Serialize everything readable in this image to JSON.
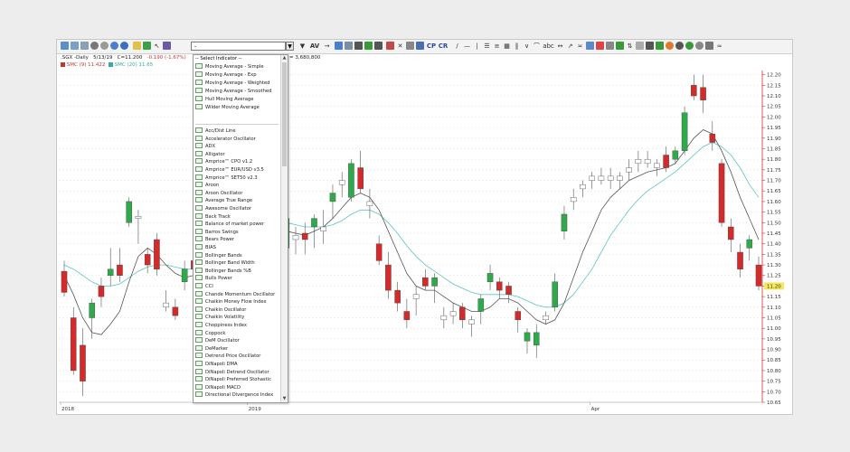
{
  "toolbar": {
    "indicator_select_value": "-",
    "chart_type_label": "AV",
    "cp_label": "CP",
    "cr_label": "CR",
    "abc_label": "abc"
  },
  "chart_header": {
    "symbol": ".SGX -Daily",
    "date": "5/13/19",
    "close": "C=11.200",
    "change": "-0.190 (-1.67%)",
    "volume": "= 3,680,800",
    "legend": [
      {
        "label": "SMC (9) 11.422",
        "color": "#c0392b"
      },
      {
        "label": "SMC (20) 11.65",
        "color": "#3aa6a6"
      }
    ]
  },
  "dropdown": {
    "title": "-- Select Indicator --",
    "moving_averages": [
      "Moving Average - Simple",
      "Moving Average - Exp",
      "Moving Average - Weighted",
      "Moving Average - Smoothed",
      "Hull Moving Average",
      "Wilder Moving Average"
    ],
    "indicators": [
      "Acc/Dist Line",
      "Accelerator Oscillator",
      "ADX",
      "Alligator",
      "Amprice™ CPO v1.2",
      "Amprice™ EUR/USD v3.5",
      "Amprice™ SET50 v2.3",
      "Aroon",
      "Aroon Oscillator",
      "Average True Range",
      "Awesome Oscillator",
      "Back Track",
      "Balance of market power",
      "Barros Swings",
      "Bears Power",
      "BIAS",
      "Bollinger Bands",
      "Bollinger Band Width",
      "Bollinger Bands %B",
      "Bulls Power",
      "CCI",
      "Chande Momentum Oscillator",
      "Chaikin Money Flow Index",
      "Chaikin Oscillator",
      "Chaikin Volatility",
      "Choppiness Index",
      "Coppock",
      "DeM Oscillator",
      "DeMarker",
      "Detrend Price Oscillator",
      "DiNapoli DMA",
      "DiNapoli Detrend Oscillator",
      "DiNapoli Preferred Stohastic",
      "DiNapoli MACD",
      "Directional Divergence Index"
    ]
  },
  "chart_data": {
    "type": "candlestick",
    "x_labels": [
      "2018",
      "2019",
      "Apr"
    ],
    "y_ticks": [
      12.2,
      12.15,
      12.1,
      12.05,
      12.0,
      11.95,
      11.9,
      11.85,
      11.8,
      11.75,
      11.7,
      11.65,
      11.6,
      11.55,
      11.5,
      11.45,
      11.4,
      11.35,
      11.3,
      11.25,
      11.2,
      11.15,
      11.1,
      11.05,
      11.0,
      10.95,
      10.9,
      10.85,
      10.8,
      10.75,
      10.7,
      10.65
    ],
    "ylim": [
      10.65,
      12.22
    ],
    "last_price": "11.20",
    "colors": {
      "up": "#2eaa4a",
      "down": "#d42a2a",
      "neutral": "#ffffff",
      "ma_fast": "#555555",
      "ma_slow": "#5cc4c4",
      "last_price_bg": "#f5e65a"
    },
    "candles": [
      {
        "o": 11.27,
        "h": 11.32,
        "l": 11.15,
        "c": 11.17
      },
      {
        "o": 11.05,
        "h": 11.1,
        "l": 10.78,
        "c": 10.8
      },
      {
        "o": 10.92,
        "h": 11.0,
        "l": 10.68,
        "c": 10.75
      },
      {
        "o": 11.05,
        "h": 11.14,
        "l": 10.95,
        "c": 11.12
      },
      {
        "o": 11.2,
        "h": 11.24,
        "l": 11.1,
        "c": 11.15
      },
      {
        "o": 11.25,
        "h": 11.38,
        "l": 11.2,
        "c": 11.28
      },
      {
        "o": 11.3,
        "h": 11.38,
        "l": 11.22,
        "c": 11.25
      },
      {
        "o": 11.5,
        "h": 11.62,
        "l": 11.48,
        "c": 11.6
      },
      {
        "o": 11.52,
        "h": 11.56,
        "l": 11.4,
        "c": 11.53
      },
      {
        "o": 11.35,
        "h": 11.38,
        "l": 11.26,
        "c": 11.3
      },
      {
        "o": 11.42,
        "h": 11.45,
        "l": 11.25,
        "c": 11.28
      },
      {
        "o": 11.12,
        "h": 11.18,
        "l": 11.08,
        "c": 11.1
      },
      {
        "o": 11.1,
        "h": 11.14,
        "l": 11.04,
        "c": 11.06
      },
      {
        "o": 11.22,
        "h": 11.32,
        "l": 11.18,
        "c": 11.28
      },
      {
        "o": 11.32,
        "h": 11.36,
        "l": 11.24,
        "c": 11.28
      },
      {
        "o": 11.66,
        "h": 11.72,
        "l": 11.55,
        "c": 11.6
      },
      {
        "o": 11.75,
        "h": 11.82,
        "l": 11.6,
        "c": 11.7
      },
      {
        "o": 11.8,
        "h": 11.86,
        "l": 11.7,
        "c": 11.78
      },
      {
        "o": 11.72,
        "h": 11.78,
        "l": 11.65,
        "c": 11.74
      },
      {
        "o": 11.72,
        "h": 11.76,
        "l": 11.45,
        "c": 11.48
      },
      {
        "o": 11.48,
        "h": 11.52,
        "l": 11.3,
        "c": 11.34
      },
      {
        "o": 11.36,
        "h": 11.42,
        "l": 11.32,
        "c": 11.38
      },
      {
        "o": 11.48,
        "h": 11.52,
        "l": 11.42,
        "c": 11.5
      },
      {
        "o": 11.48,
        "h": 11.52,
        "l": 11.36,
        "c": 11.4
      },
      {
        "o": 11.38,
        "h": 11.56,
        "l": 11.34,
        "c": 11.52
      },
      {
        "o": 11.42,
        "h": 11.48,
        "l": 11.35,
        "c": 11.44
      },
      {
        "o": 11.45,
        "h": 11.5,
        "l": 11.35,
        "c": 11.42
      },
      {
        "o": 11.48,
        "h": 11.54,
        "l": 11.38,
        "c": 11.52
      },
      {
        "o": 11.46,
        "h": 11.56,
        "l": 11.4,
        "c": 11.48
      },
      {
        "o": 11.6,
        "h": 11.68,
        "l": 11.52,
        "c": 11.64
      },
      {
        "o": 11.68,
        "h": 11.74,
        "l": 11.62,
        "c": 11.7
      },
      {
        "o": 11.62,
        "h": 11.8,
        "l": 11.6,
        "c": 11.78
      },
      {
        "o": 11.76,
        "h": 11.84,
        "l": 11.64,
        "c": 11.66
      },
      {
        "o": 11.6,
        "h": 11.66,
        "l": 11.52,
        "c": 11.58
      },
      {
        "o": 11.4,
        "h": 11.44,
        "l": 11.3,
        "c": 11.32
      },
      {
        "o": 11.3,
        "h": 11.36,
        "l": 11.14,
        "c": 11.18
      },
      {
        "o": 11.18,
        "h": 11.22,
        "l": 11.08,
        "c": 11.12
      },
      {
        "o": 11.08,
        "h": 11.14,
        "l": 11.0,
        "c": 11.04
      },
      {
        "o": 11.14,
        "h": 11.2,
        "l": 11.06,
        "c": 11.16
      },
      {
        "o": 11.24,
        "h": 11.28,
        "l": 11.18,
        "c": 11.2
      },
      {
        "o": 11.2,
        "h": 11.26,
        "l": 11.12,
        "c": 11.24
      },
      {
        "o": 11.06,
        "h": 11.1,
        "l": 11.0,
        "c": 11.04
      },
      {
        "o": 11.08,
        "h": 11.12,
        "l": 11.02,
        "c": 11.06
      },
      {
        "o": 11.1,
        "h": 11.12,
        "l": 11.0,
        "c": 11.04
      },
      {
        "o": 11.02,
        "h": 11.06,
        "l": 10.96,
        "c": 11.04
      },
      {
        "o": 11.08,
        "h": 11.16,
        "l": 11.02,
        "c": 11.14
      },
      {
        "o": 11.22,
        "h": 11.3,
        "l": 11.18,
        "c": 11.26
      },
      {
        "o": 11.22,
        "h": 11.24,
        "l": 11.14,
        "c": 11.18
      },
      {
        "o": 11.2,
        "h": 11.22,
        "l": 11.12,
        "c": 11.16
      },
      {
        "o": 11.08,
        "h": 11.1,
        "l": 10.98,
        "c": 11.04
      },
      {
        "o": 10.94,
        "h": 11.0,
        "l": 10.88,
        "c": 10.98
      },
      {
        "o": 10.92,
        "h": 11.02,
        "l": 10.86,
        "c": 10.98
      },
      {
        "o": 11.04,
        "h": 11.08,
        "l": 11.02,
        "c": 11.06
      },
      {
        "o": 11.1,
        "h": 11.26,
        "l": 11.08,
        "c": 11.22
      },
      {
        "o": 11.46,
        "h": 11.58,
        "l": 11.42,
        "c": 11.54
      },
      {
        "o": 11.6,
        "h": 11.66,
        "l": 11.56,
        "c": 11.62
      },
      {
        "o": 11.66,
        "h": 11.7,
        "l": 11.62,
        "c": 11.68
      },
      {
        "o": 11.7,
        "h": 11.74,
        "l": 11.66,
        "c": 11.72
      },
      {
        "o": 11.72,
        "h": 11.76,
        "l": 11.68,
        "c": 11.7
      },
      {
        "o": 11.72,
        "h": 11.76,
        "l": 11.66,
        "c": 11.7
      },
      {
        "o": 11.7,
        "h": 11.74,
        "l": 11.66,
        "c": 11.72
      },
      {
        "o": 11.74,
        "h": 11.8,
        "l": 11.7,
        "c": 11.76
      },
      {
        "o": 11.78,
        "h": 11.84,
        "l": 11.74,
        "c": 11.8
      },
      {
        "o": 11.8,
        "h": 11.84,
        "l": 11.76,
        "c": 11.78
      },
      {
        "o": 11.76,
        "h": 11.8,
        "l": 11.72,
        "c": 11.78
      },
      {
        "o": 11.82,
        "h": 11.86,
        "l": 11.74,
        "c": 11.76
      },
      {
        "o": 11.8,
        "h": 11.86,
        "l": 11.78,
        "c": 11.84
      },
      {
        "o": 11.84,
        "h": 12.05,
        "l": 11.82,
        "c": 12.02
      },
      {
        "o": 12.15,
        "h": 12.2,
        "l": 12.08,
        "c": 12.1
      },
      {
        "o": 12.14,
        "h": 12.2,
        "l": 12.02,
        "c": 12.08
      },
      {
        "o": 11.92,
        "h": 11.98,
        "l": 11.84,
        "c": 11.88
      },
      {
        "o": 11.78,
        "h": 11.8,
        "l": 11.48,
        "c": 11.5
      },
      {
        "o": 11.48,
        "h": 11.52,
        "l": 11.36,
        "c": 11.42
      },
      {
        "o": 11.36,
        "h": 11.4,
        "l": 11.24,
        "c": 11.28
      },
      {
        "o": 11.38,
        "h": 11.44,
        "l": 11.32,
        "c": 11.42
      },
      {
        "o": 11.3,
        "h": 11.34,
        "l": 11.18,
        "c": 11.2
      }
    ],
    "ma_fast": [
      11.25,
      11.16,
      11.05,
      10.98,
      10.97,
      11.02,
      11.08,
      11.22,
      11.34,
      11.38,
      11.35,
      11.3,
      11.26,
      11.24,
      11.25,
      11.35,
      11.48,
      11.6,
      11.66,
      11.64,
      11.58,
      11.52,
      11.48,
      11.46,
      11.46,
      11.45,
      11.44,
      11.46,
      11.48,
      11.52,
      11.57,
      11.62,
      11.64,
      11.62,
      11.56,
      11.46,
      11.36,
      11.26,
      11.2,
      11.18,
      11.18,
      11.15,
      11.12,
      11.1,
      11.08,
      11.08,
      11.1,
      11.14,
      11.14,
      11.12,
      11.08,
      11.04,
      11.02,
      11.04,
      11.12,
      11.24,
      11.36,
      11.46,
      11.56,
      11.62,
      11.66,
      11.7,
      11.72,
      11.74,
      11.75,
      11.76,
      11.78,
      11.84,
      11.9,
      11.94,
      11.92,
      11.84,
      11.74,
      11.62,
      11.52,
      11.42
    ],
    "ma_slow": [
      11.3,
      11.28,
      11.25,
      11.22,
      11.2,
      11.2,
      11.21,
      11.24,
      11.27,
      11.29,
      11.3,
      11.3,
      11.29,
      11.28,
      11.28,
      11.31,
      11.36,
      11.42,
      11.47,
      11.51,
      11.53,
      11.53,
      11.52,
      11.51,
      11.5,
      11.49,
      11.48,
      11.48,
      11.48,
      11.49,
      11.51,
      11.54,
      11.56,
      11.56,
      11.54,
      11.5,
      11.45,
      11.39,
      11.34,
      11.3,
      11.27,
      11.24,
      11.21,
      11.19,
      11.17,
      11.16,
      11.16,
      11.16,
      11.16,
      11.15,
      11.13,
      11.11,
      11.1,
      11.1,
      11.12,
      11.16,
      11.22,
      11.28,
      11.36,
      11.44,
      11.5,
      11.56,
      11.61,
      11.65,
      11.68,
      11.71,
      11.74,
      11.78,
      11.82,
      11.86,
      11.88,
      11.86,
      11.82,
      11.76,
      11.68,
      11.62
    ]
  }
}
